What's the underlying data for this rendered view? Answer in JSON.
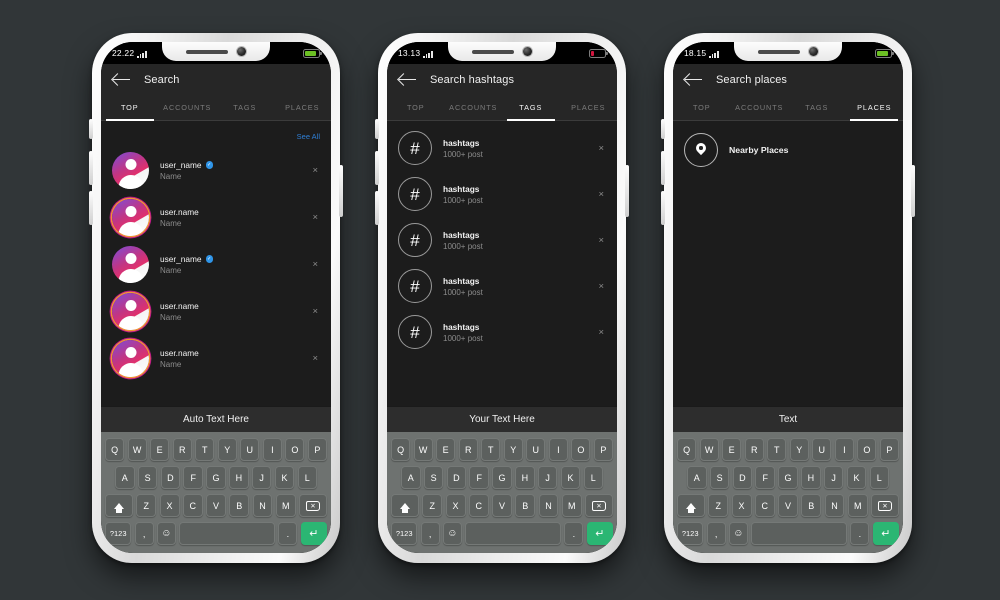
{
  "background_color": "#313638",
  "phones": [
    {
      "id": "phone-search-top",
      "status": {
        "time": "22.22",
        "battery_color": "#6cc024",
        "battery_level": 85
      },
      "header": {
        "title": "Search",
        "back_icon": "back-arrow-icon"
      },
      "tabs": [
        {
          "label": "TOP",
          "active": true
        },
        {
          "label": "ACCOUNTS",
          "active": false
        },
        {
          "label": "TAGS",
          "active": false
        },
        {
          "label": "PLACES",
          "active": false
        }
      ],
      "see_all": "See All",
      "list_type": "accounts",
      "rows": [
        {
          "title": "user_name",
          "subtitle": "Name",
          "verified": true,
          "ring": false,
          "close": "×"
        },
        {
          "title": "user.name",
          "subtitle": "Name",
          "verified": false,
          "ring": true,
          "close": "×"
        },
        {
          "title": "user_name",
          "subtitle": "Name",
          "verified": true,
          "ring": false,
          "close": "×"
        },
        {
          "title": "user.name",
          "subtitle": "Name",
          "verified": false,
          "ring": true,
          "close": "×"
        },
        {
          "title": "user.name",
          "subtitle": "Name",
          "verified": false,
          "ring": false,
          "close": "×"
        }
      ],
      "suggestion_bar": "Auto Text Here"
    },
    {
      "id": "phone-search-hashtags",
      "status": {
        "time": "13.13",
        "battery_color": "#d2163f",
        "battery_level": 22
      },
      "header": {
        "title": "Search hashtags",
        "back_icon": "back-arrow-icon"
      },
      "tabs": [
        {
          "label": "TOP",
          "active": false
        },
        {
          "label": "ACCOUNTS",
          "active": false
        },
        {
          "label": "TAGS",
          "active": true
        },
        {
          "label": "PLACES",
          "active": false
        }
      ],
      "see_all": "",
      "list_type": "hashtags",
      "rows": [
        {
          "title": "hashtags",
          "subtitle": "1000+ post",
          "icon": "hash-icon",
          "close": "×"
        },
        {
          "title": "hashtags",
          "subtitle": "1000+ post",
          "icon": "hash-icon",
          "close": "×"
        },
        {
          "title": "hashtags",
          "subtitle": "1000+ post",
          "icon": "hash-icon",
          "close": "×"
        },
        {
          "title": "hashtags",
          "subtitle": "1000+ post",
          "icon": "hash-icon",
          "close": "×"
        },
        {
          "title": "hashtags",
          "subtitle": "1000+ post",
          "icon": "hash-icon",
          "close": "×"
        }
      ],
      "suggestion_bar": "Your Text Here"
    },
    {
      "id": "phone-search-places",
      "status": {
        "time": "18.15",
        "battery_color": "#6cc024",
        "battery_level": 85
      },
      "header": {
        "title": "Search places",
        "back_icon": "back-arrow-icon"
      },
      "tabs": [
        {
          "label": "TOP",
          "active": false
        },
        {
          "label": "ACCOUNTS",
          "active": false
        },
        {
          "label": "TAGS",
          "active": false
        },
        {
          "label": "PLACES",
          "active": true
        }
      ],
      "see_all": "",
      "list_type": "places",
      "rows": [
        {
          "title": "Nearby Places",
          "subtitle": "",
          "icon": "map-pin-icon"
        }
      ],
      "suggestion_bar": "Text"
    }
  ],
  "keyboard": {
    "row1": [
      "Q",
      "W",
      "E",
      "R",
      "T",
      "Y",
      "U",
      "I",
      "O",
      "P"
    ],
    "row2": [
      "A",
      "S",
      "D",
      "F",
      "G",
      "H",
      "J",
      "K",
      "L"
    ],
    "row3_shift": "shift-icon",
    "row3": [
      "Z",
      "X",
      "C",
      "V",
      "B",
      "N",
      "M"
    ],
    "row3_backspace": "backspace-icon",
    "row4": {
      "symbols": "?123",
      "comma": ",",
      "emoji": "☺",
      "space": "",
      "period": ".",
      "enter": "↵"
    },
    "accent_enter_color": "#2bb673"
  }
}
